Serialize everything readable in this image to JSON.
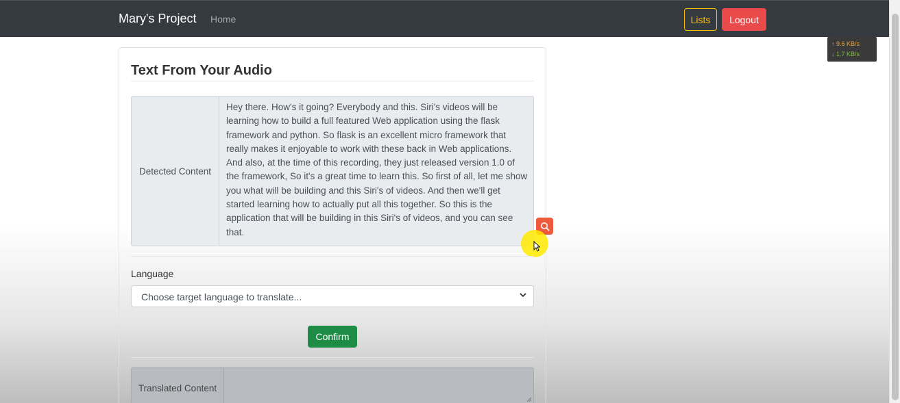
{
  "navbar": {
    "brand": "Mary's Project",
    "home_link": "Home",
    "lists_button": "Lists",
    "logout_button": "Logout"
  },
  "net_speed": {
    "upload": "↑ 9.6 KB/s",
    "download": "↓ 1.7 KB/s"
  },
  "card": {
    "title": "Text From Your Audio",
    "detected_label": "Detected Content",
    "detected_text": "Hey there. How's it going? Everybody and this. Siri's videos will be learning how to build a full featured Web application using the flask framework and python. So flask is an excellent micro framework that really makes it enjoyable to work with these back in Web applications. And also, at the time of this recording, they just released version 1.0 of the framework, So it's a great time to learn this. So first of all, let me show you what will be building and this Siri's of videos. And then we'll get started learning how to actually put all this together. So this is the application that will be building in this Siri's of videos, and you can see that.",
    "language_label": "Language",
    "language_select_value": "Choose target language to translate...",
    "confirm_button": "Confirm",
    "translated_label": "Translated Content",
    "translated_text": ""
  },
  "icons": {
    "search_badge": "search-icon",
    "select_chevron": "chevron-down-icon"
  },
  "colors": {
    "navbar_bg": "#343a40",
    "lists_outline": "#ffc107",
    "logout_bg": "#ea4a4a",
    "confirm_bg": "#1e8c45",
    "search_badge_bg": "#f05a3c"
  }
}
